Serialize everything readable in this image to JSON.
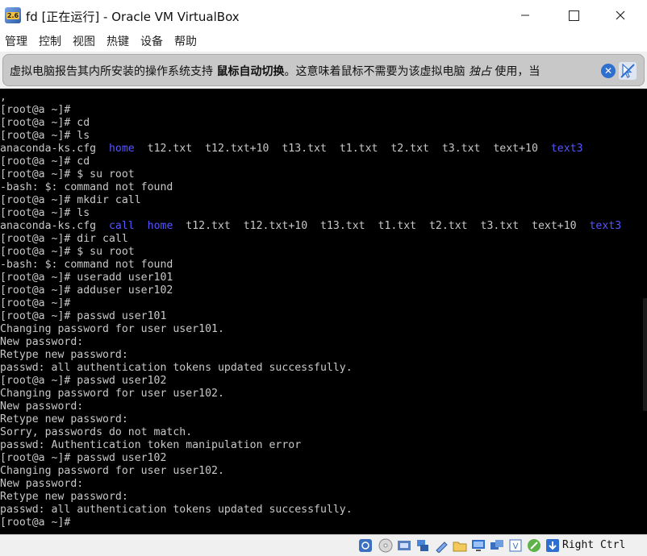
{
  "window": {
    "title": "fd [正在运行] - Oracle VM VirtualBox",
    "icon_label": "2.6"
  },
  "menu": [
    "管理",
    "控制",
    "视图",
    "热键",
    "设备",
    "帮助"
  ],
  "notification": {
    "text_before": "虚拟电脑报告其内所安装的操作系统支持 ",
    "bold": "鼠标自动切换",
    "text_middle": "。这意味着鼠标不需要为该虚拟电脑 ",
    "italic": "独占",
    "text_after": " 使用，当"
  },
  "terminal": {
    "lines": [
      [
        {
          "t": ","
        }
      ],
      [
        {
          "t": "[root@a ~]#"
        }
      ],
      [
        {
          "t": "[root@a ~]# cd"
        }
      ],
      [
        {
          "t": "[root@a ~]# ls"
        }
      ],
      [
        {
          "t": "anaconda-ks.cfg  "
        },
        {
          "t": "home",
          "blue": true
        },
        {
          "t": "  t12.txt  t12.txt+10  t13.txt  t1.txt  t2.txt  t3.txt  text+10  "
        },
        {
          "t": "text3",
          "blue": true
        }
      ],
      [
        {
          "t": "[root@a ~]# cd"
        }
      ],
      [
        {
          "t": "[root@a ~]# $ su root"
        }
      ],
      [
        {
          "t": "-bash: $: command not found"
        }
      ],
      [
        {
          "t": "[root@a ~]# mkdir call"
        }
      ],
      [
        {
          "t": "[root@a ~]# ls"
        }
      ],
      [
        {
          "t": "anaconda-ks.cfg  "
        },
        {
          "t": "call",
          "blue": true
        },
        {
          "t": "  "
        },
        {
          "t": "home",
          "blue": true
        },
        {
          "t": "  t12.txt  t12.txt+10  t13.txt  t1.txt  t2.txt  t3.txt  text+10  "
        },
        {
          "t": "text3",
          "blue": true
        }
      ],
      [
        {
          "t": "[root@a ~]# dir call"
        }
      ],
      [
        {
          "t": "[root@a ~]# $ su root"
        }
      ],
      [
        {
          "t": "-bash: $: command not found"
        }
      ],
      [
        {
          "t": "[root@a ~]# useradd user101"
        }
      ],
      [
        {
          "t": "[root@a ~]# adduser user102"
        }
      ],
      [
        {
          "t": "[root@a ~]#"
        }
      ],
      [
        {
          "t": "[root@a ~]# passwd user101"
        }
      ],
      [
        {
          "t": "Changing password for user user101."
        }
      ],
      [
        {
          "t": "New password:"
        }
      ],
      [
        {
          "t": "Retype new password:"
        }
      ],
      [
        {
          "t": "passwd: all authentication tokens updated successfully."
        }
      ],
      [
        {
          "t": "[root@a ~]# passwd user102"
        }
      ],
      [
        {
          "t": "Changing password for user user102."
        }
      ],
      [
        {
          "t": "New password:"
        }
      ],
      [
        {
          "t": "Retype new password:"
        }
      ],
      [
        {
          "t": "Sorry, passwords do not match."
        }
      ],
      [
        {
          "t": "passwd: Authentication token manipulation error"
        }
      ],
      [
        {
          "t": "[root@a ~]# passwd user102"
        }
      ],
      [
        {
          "t": "Changing password for user user102."
        }
      ],
      [
        {
          "t": "New password:"
        }
      ],
      [
        {
          "t": "Retype new password:"
        }
      ],
      [
        {
          "t": "passwd: all authentication tokens updated successfully."
        }
      ],
      [
        {
          "t": "[root@a ~]#"
        }
      ]
    ]
  },
  "statusbar": {
    "host_key": "Right Ctrl",
    "icons": [
      "hard-disk-icon",
      "optical-drive-icon",
      "audio-icon",
      "network-icon",
      "usb-icon",
      "shared-folder-icon",
      "display-icon",
      "recording-icon",
      "cpu-icon",
      "mouse-integration-icon",
      "keyboard-capture-icon"
    ]
  },
  "colors": {
    "terminal_bg": "#000000",
    "terminal_fg": "#c8c8c8",
    "directory": "#5555ff"
  }
}
